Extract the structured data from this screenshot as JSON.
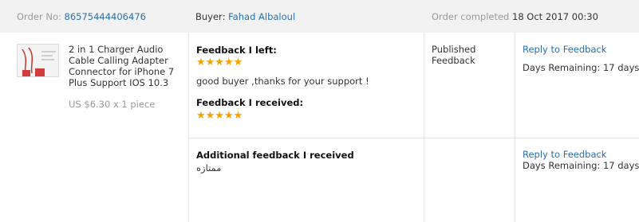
{
  "header": {
    "order_no_label": "Order No:",
    "order_no_value": "86575444406476",
    "buyer_label": "Buyer:",
    "buyer_value": "Fahad Albaloul",
    "status_label": "Order completed",
    "status_date": "18 Oct 2017 00:30"
  },
  "product": {
    "image_icon": "product-thumbnail",
    "title": "2 in 1 Charger Audio Cable Calling Adapter Connector for iPhone 7 Plus Support IOS 10.3",
    "price": "US $6.30 x 1 piece"
  },
  "feedback_left": {
    "label": "Feedback I left:",
    "stars": 5,
    "stars_text": "★★★★★",
    "comment": "good buyer ,thanks for your support !"
  },
  "feedback_received": {
    "label": "Feedback I received:",
    "stars": 5,
    "stars_text": "★★★★★"
  },
  "additional": {
    "label": "Additional feedback I received",
    "comment": "ممتازه"
  },
  "status": {
    "line1": "Published",
    "line2": "Feedback"
  },
  "actions": {
    "reply_1": "Reply to Feedback",
    "days_remaining_1": "Days Remaining: 17 days",
    "reply_2": "Reply to Feedback",
    "days_remaining_2": "Days Remaining: 17 days"
  },
  "colors": {
    "link": "#2a6fb0",
    "star": "#f6a100",
    "header_bg": "#f2f2f2",
    "muted": "#999999"
  }
}
